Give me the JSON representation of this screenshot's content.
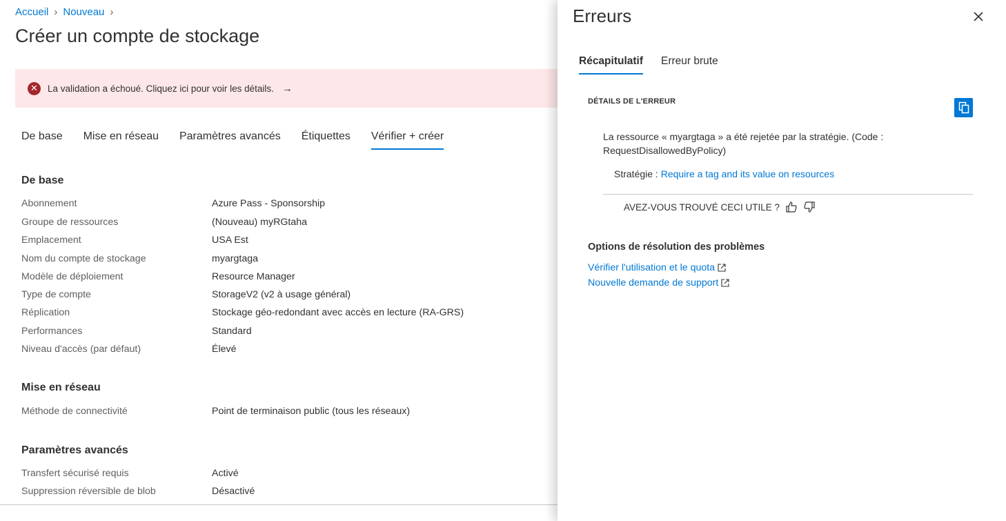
{
  "breadcrumb": [
    "Accueil",
    "Nouveau"
  ],
  "page_title": "Créer un compte de stockage",
  "validation_banner": {
    "text": "La validation a échoué. Cliquez ici pour voir les détails.",
    "arrow": "→"
  },
  "tabs": [
    "De base",
    "Mise en réseau",
    "Paramètres avancés",
    "Étiquettes",
    "Vérifier + créer"
  ],
  "active_tab": "Vérifier + créer",
  "sections": [
    {
      "title": "De base",
      "rows": [
        {
          "key": "Abonnement",
          "value": "Azure Pass - Sponsorship"
        },
        {
          "key": "Groupe de ressources",
          "value": "(Nouveau) myRGtaha"
        },
        {
          "key": "Emplacement",
          "value": "USA Est"
        },
        {
          "key": "Nom du compte de stockage",
          "value": "myargtaga"
        },
        {
          "key": "Modèle de déploiement",
          "value": "Resource Manager"
        },
        {
          "key": "Type de compte",
          "value": "StorageV2 (v2 à usage général)"
        },
        {
          "key": "Réplication",
          "value": "Stockage géo-redondant avec accès en lecture (RA-GRS)"
        },
        {
          "key": "Performances",
          "value": "Standard"
        },
        {
          "key": "Niveau d'accès (par défaut)",
          "value": "Élevé"
        }
      ]
    },
    {
      "title": "Mise en réseau",
      "rows": [
        {
          "key": "Méthode de connectivité",
          "value": "Point de terminaison public (tous les réseaux)"
        }
      ]
    },
    {
      "title": "Paramètres avancés",
      "rows": [
        {
          "key": "Transfert sécurisé requis",
          "value": "Activé"
        },
        {
          "key": "Suppression réversible de blob",
          "value": "Désactivé"
        }
      ]
    }
  ],
  "panel": {
    "title": "Erreurs",
    "tabs": [
      "Récapitulatif",
      "Erreur brute"
    ],
    "details_label": "DÉTAILS DE L'ERREUR",
    "error_message": "La ressource « myargtaga » a été rejetée par la stratégie. (Code : RequestDisallowedByPolicy)",
    "policy_label": "Stratégie : ",
    "policy_link": "Require a tag and its value on resources",
    "helpful_question": "AVEZ-VOUS TROUVÉ CECI UTILE ?",
    "options_title": "Options de résolution des problèmes",
    "options_links": [
      "Vérifier l'utilisation et le quota",
      "Nouvelle demande de support"
    ]
  },
  "colors": {
    "accent": "#0078d4",
    "error": "#a4262c",
    "banner_bg": "#fde7e9"
  },
  "icons": [
    "chevron-right-icon",
    "error-circle-icon",
    "arrow-right-icon",
    "close-icon",
    "copy-icon",
    "thumbs-up-icon",
    "thumbs-down-icon",
    "external-link-icon"
  ]
}
